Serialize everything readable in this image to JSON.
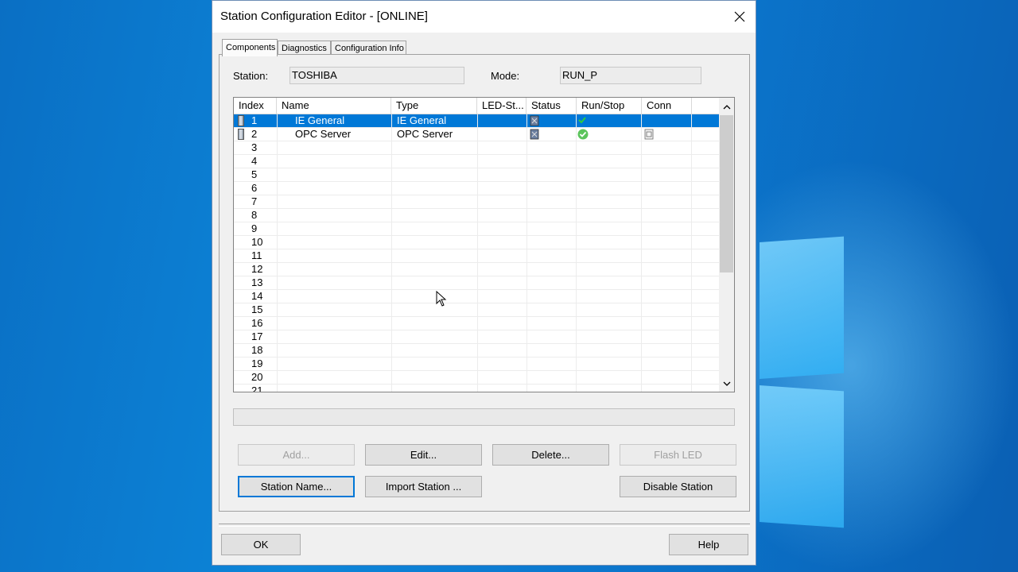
{
  "window": {
    "title": "Station Configuration Editor - [ONLINE]",
    "close_glyph": "✕"
  },
  "tabs": [
    {
      "label": "Components",
      "active": true
    },
    {
      "label": "Diagnostics",
      "active": false
    },
    {
      "label": "Configuration Info",
      "active": false
    }
  ],
  "station": {
    "label": "Station:",
    "value": "TOSHIBA"
  },
  "mode": {
    "label": "Mode:",
    "value": "RUN_P"
  },
  "table": {
    "columns": [
      "Index",
      "Name",
      "Type",
      "LED-St...",
      "Status",
      "Run/Stop",
      "Conn"
    ],
    "rows": [
      {
        "index": "1",
        "name": "IE General",
        "type": "IE General",
        "selected": true,
        "status_icon": "module-status-icon",
        "runstop_icon": "checkmark-icon",
        "conn_icon": ""
      },
      {
        "index": "2",
        "name": "OPC Server",
        "type": "OPC Server",
        "selected": false,
        "status_icon": "module-status-icon",
        "runstop_icon": "green-check-circle-icon",
        "conn_icon": "connection-icon"
      },
      {
        "index": "3"
      },
      {
        "index": "4"
      },
      {
        "index": "5"
      },
      {
        "index": "6"
      },
      {
        "index": "7"
      },
      {
        "index": "8"
      },
      {
        "index": "9"
      },
      {
        "index": "10"
      },
      {
        "index": "11"
      },
      {
        "index": "12"
      },
      {
        "index": "13"
      },
      {
        "index": "14"
      },
      {
        "index": "15"
      },
      {
        "index": "16"
      },
      {
        "index": "17"
      },
      {
        "index": "18"
      },
      {
        "index": "19"
      },
      {
        "index": "20"
      },
      {
        "index": "21"
      }
    ]
  },
  "buttons": {
    "add": "Add...",
    "edit": "Edit...",
    "delete": "Delete...",
    "flash_led": "Flash LED",
    "station_name": "Station Name...",
    "import_station": "Import Station ...",
    "disable_station": "Disable Station",
    "ok": "OK",
    "help": "Help"
  },
  "colors": {
    "selection": "#0078d7",
    "dialog_bg": "#f0f0f0",
    "desktop": "#0b7fd4"
  }
}
